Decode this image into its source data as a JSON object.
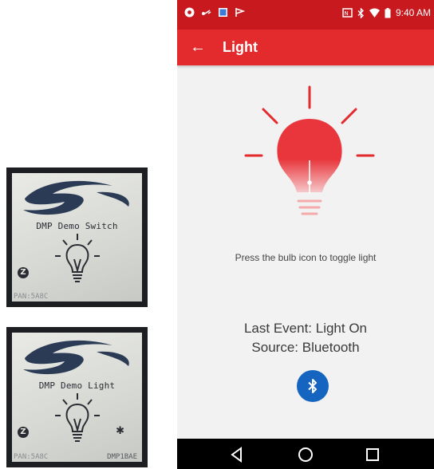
{
  "lcd_switch": {
    "title": "DMP Demo Switch",
    "zwave_glyph": "Z",
    "pan": "PAN:5A8C"
  },
  "lcd_light": {
    "title": "DMP Demo Light",
    "zwave_glyph": "Z",
    "bluetooth_glyph": "✱",
    "pan": "PAN:5A8C",
    "device_id": "DMP1BAE"
  },
  "status_bar": {
    "time": "9:40 AM",
    "left_icons": [
      "chrome-icon",
      "usb-icon",
      "gallery-icon",
      "flag-icon"
    ],
    "right_icons": [
      "nfc-icon",
      "bluetooth-icon",
      "wifi-icon",
      "battery-icon"
    ]
  },
  "app_bar": {
    "back_glyph": "←",
    "title": "Light"
  },
  "bulb": {
    "state": "on",
    "color": "#e8363c"
  },
  "hint_text": "Press the bulb icon to toggle light",
  "event": {
    "last_event": "Last Event: Light On",
    "source": "Source: Bluetooth"
  },
  "bluetooth_button": {
    "icon": "bluetooth-icon",
    "color": "#1565c0"
  },
  "nav": {
    "back": "back-icon",
    "home": "home-icon",
    "recents": "recents-icon"
  },
  "colors": {
    "status_bar": "#c8191f",
    "app_bar": "#e32b2d",
    "background": "#f2f2f2"
  }
}
